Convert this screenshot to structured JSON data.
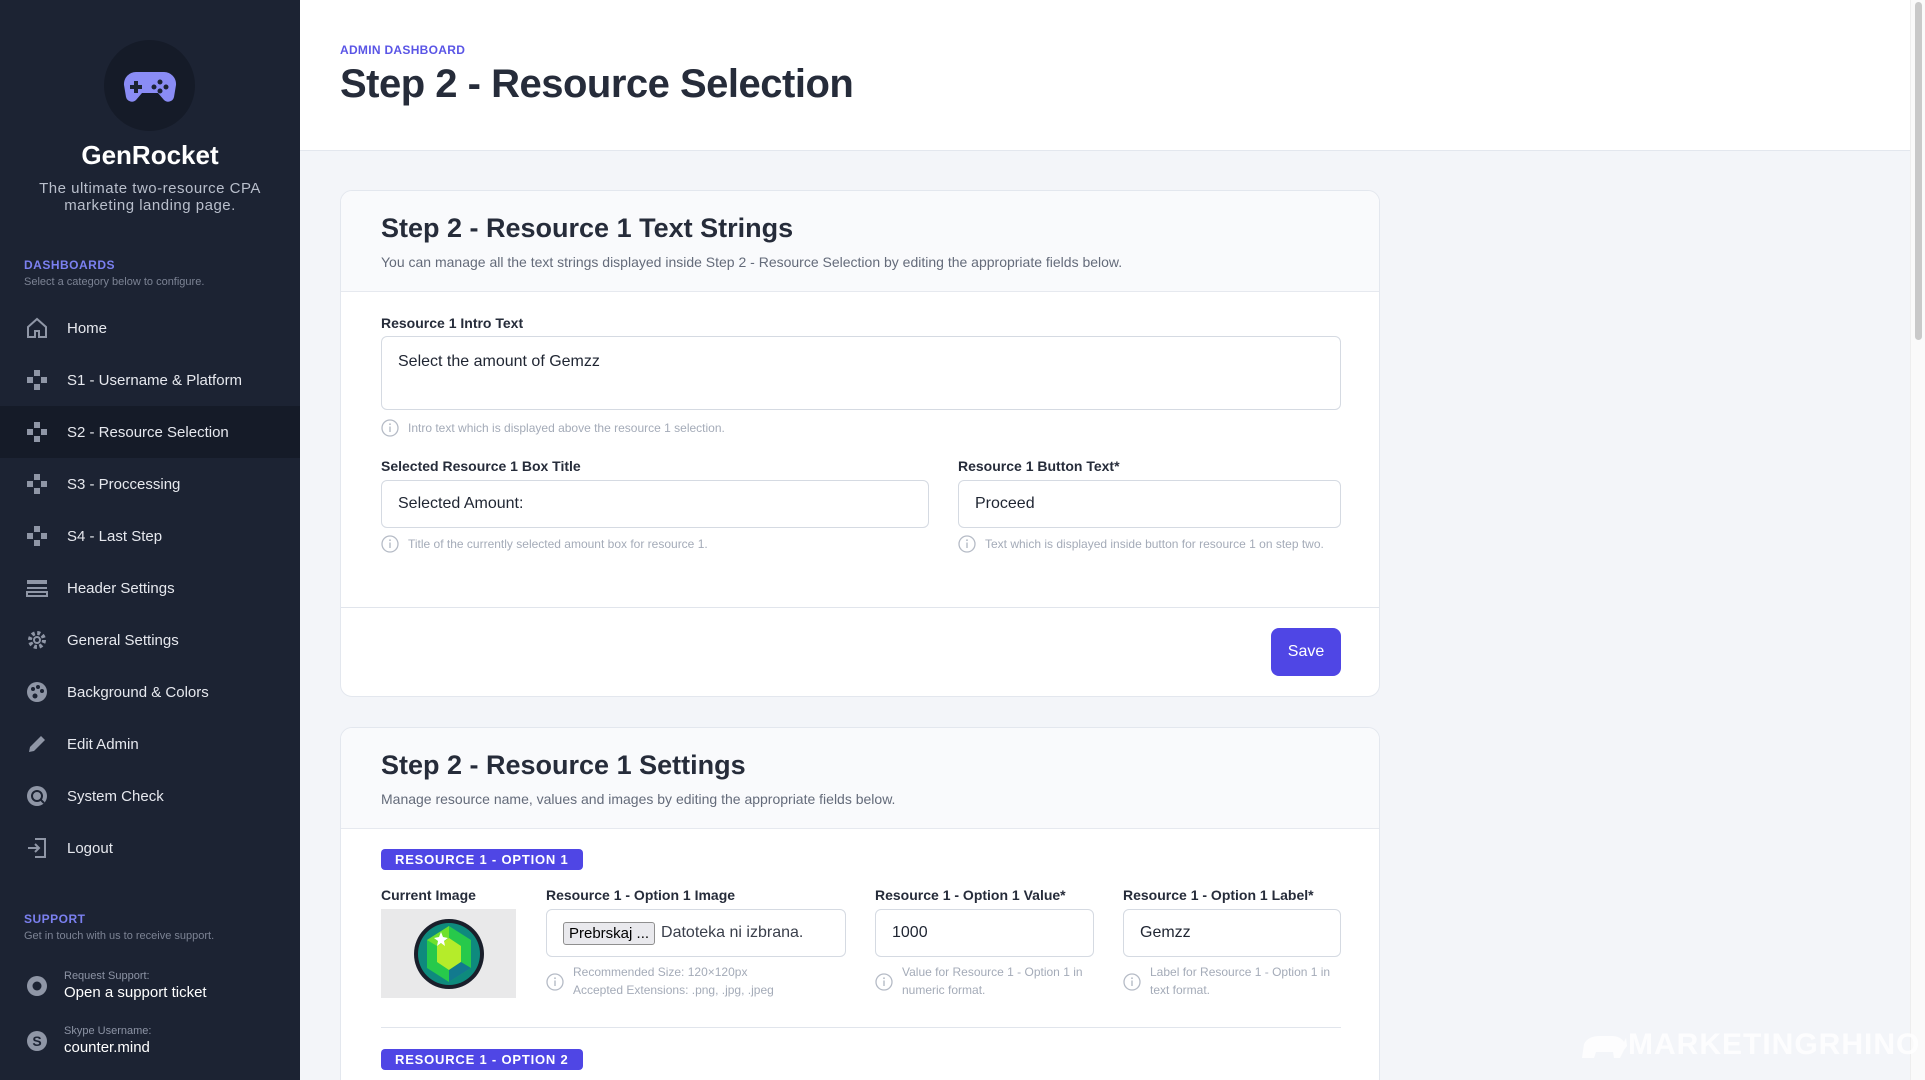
{
  "sidebar": {
    "brand": "GenRocket",
    "tagline": "The ultimate two-resource CPA marketing landing page.",
    "dashboards_title": "DASHBOARDS",
    "dashboards_sub": "Select a category below to configure.",
    "items": [
      {
        "label": "Home",
        "icon": "home-icon"
      },
      {
        "label": "S1 - Username & Platform",
        "icon": "gamepad-icon"
      },
      {
        "label": "S2 - Resource Selection",
        "icon": "gamepad-icon",
        "active": true
      },
      {
        "label": "S3 - Proccessing",
        "icon": "gamepad-icon"
      },
      {
        "label": "S4 - Last Step",
        "icon": "gamepad-icon"
      },
      {
        "label": "Header Settings",
        "icon": "header-icon"
      },
      {
        "label": "General Settings",
        "icon": "gear-icon"
      },
      {
        "label": "Background & Colors",
        "icon": "palette-icon"
      },
      {
        "label": "Edit Admin",
        "icon": "pencil-icon"
      },
      {
        "label": "System Check",
        "icon": "check-icon"
      },
      {
        "label": "Logout",
        "icon": "logout-icon"
      }
    ],
    "support_title": "SUPPORT",
    "support_sub": "Get in touch with us to receive support.",
    "request_small": "Request Support:",
    "request_big": "Open a support ticket",
    "skype_small": "Skype Username:",
    "skype_big": "counter.mind"
  },
  "header": {
    "breadcrumb": "ADMIN DASHBOARD",
    "title": "Step 2 - Resource Selection"
  },
  "card1": {
    "title": "Step 2 - Resource 1 Text Strings",
    "desc": "You can manage all the text strings displayed inside Step 2 - Resource Selection by editing the appropriate fields below.",
    "intro_label": "Resource 1 Intro Text",
    "intro_value": "Select the amount of Gemzz",
    "intro_hint": "Intro text which is displayed above the resource 1 selection.",
    "box_label": "Selected Resource 1 Box Title",
    "box_value": "Selected Amount:",
    "box_hint": "Title of the currently selected amount box for resource 1.",
    "btn_label": "Resource 1 Button Text*",
    "btn_value": "Proceed",
    "btn_hint": "Text which is displayed inside button for resource 1 on step two.",
    "save": "Save"
  },
  "card2": {
    "title": "Step 2 - Resource 1 Settings",
    "desc": "Manage resource name, values and images by editing the appropriate fields below.",
    "badge1": "RESOURCE 1 - OPTION 1",
    "badge2": "RESOURCE 1 - OPTION 2",
    "current_image_label": "Current Image",
    "image_label": "Resource 1 - Option 1 Image",
    "file_button": "Prebrskaj ...",
    "file_text": "Datoteka ni izbrana.",
    "image_hint_1": "Recommended Size: 120×120px",
    "image_hint_2": "Accepted Extensions: .png, .jpg, .jpeg",
    "value_label": "Resource 1 - Option 1 Value*",
    "value_value": "1000",
    "value_hint": "Value for Resource 1 - Option 1 in numeric format.",
    "label_label": "Resource 1 - Option 1 Label*",
    "label_value": "Gemzz",
    "label_hint": "Label for Resource 1 - Option 1 in text format."
  },
  "watermark": "MARKETINGRHINO",
  "colors": {
    "accent": "#4f46e5",
    "sidebar": "#1c2333"
  }
}
